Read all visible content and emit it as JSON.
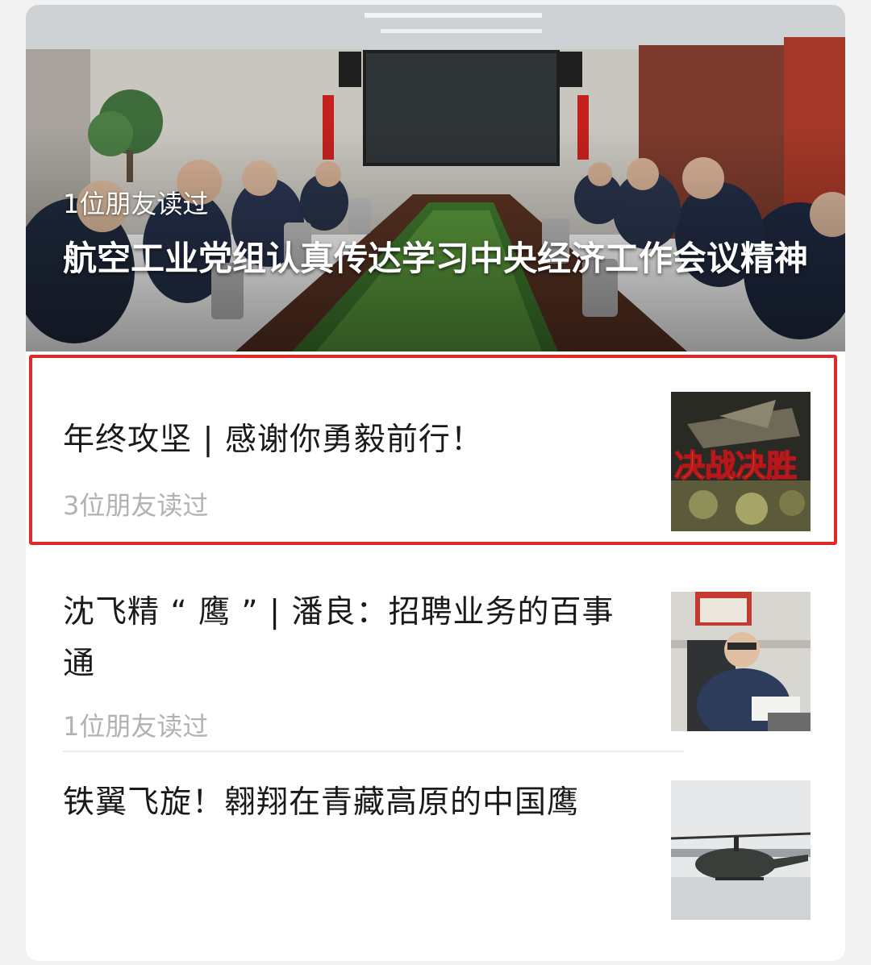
{
  "hero": {
    "read_count": "1位朋友读过",
    "title": "航空工业党组认真传达学习中央经济工作会议精神",
    "image_icon": "meeting-room-photo"
  },
  "articles": [
    {
      "title": "年终攻坚 | 感谢你勇毅前行！",
      "read_count": "3位朋友读过",
      "thumb_text": "决战决胜",
      "highlighted": true,
      "highlight_color": "#e02a2a"
    },
    {
      "title": "沈飞精 “ 鹰 ” | 潘良：招聘业务的百事通",
      "read_count": "1位朋友读过",
      "thumb_icon": "portrait-photo"
    },
    {
      "title": "铁翼飞旋！翱翔在青藏高原的中国鹰",
      "read_count": "",
      "thumb_icon": "helicopter-photo"
    }
  ],
  "colors": {
    "title": "#1a1a1a",
    "meta": "#b2b2b2",
    "highlight": "#e02a2a"
  }
}
